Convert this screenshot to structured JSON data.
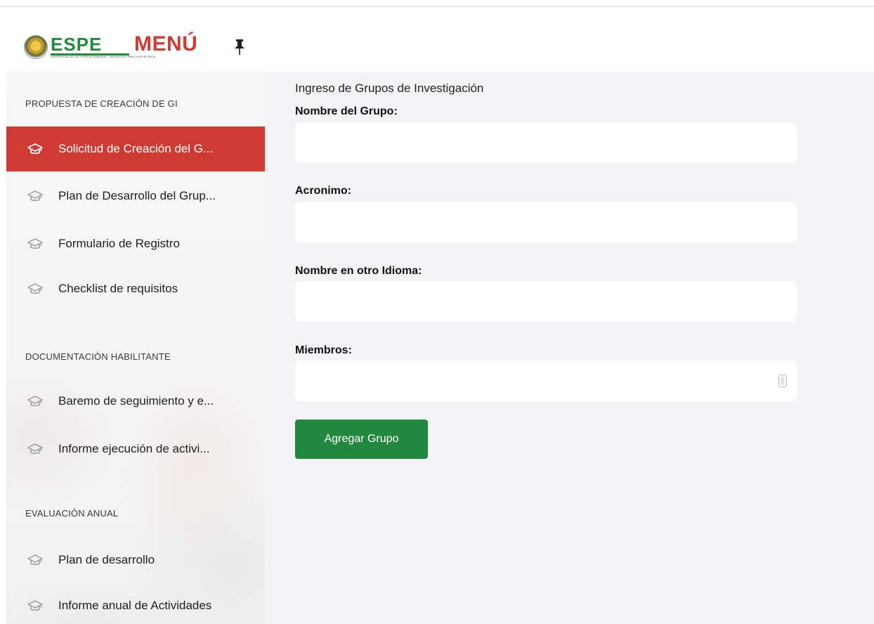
{
  "header": {
    "logo_word": "ESPE",
    "logo_tagline": "UNIVERSIDAD DE LAS FUERZAS ARMADAS · INNOVACIÓN PARA LA EXCELENCIA",
    "menu_title": "MENÚ",
    "pin_icon": "pin-icon"
  },
  "sidebar": {
    "sections": [
      {
        "title": "PROPUESTA DE CREACIÓN DE GI",
        "items": [
          {
            "label": "Solicitud de Creación del G...",
            "icon": "graduation-cap-icon",
            "active": true
          },
          {
            "label": "Plan de Desarrollo del Grup...",
            "icon": "graduation-cap-icon",
            "active": false
          },
          {
            "label": "Formulario de Registro",
            "icon": "graduation-cap-icon",
            "active": false
          },
          {
            "label": "Checklist de requisitos",
            "icon": "graduation-cap-icon",
            "active": false
          }
        ]
      },
      {
        "title": "DOCUMENTACIÓN HABILITANTE",
        "items": [
          {
            "label": "Baremo de seguimiento y e...",
            "icon": "graduation-cap-icon",
            "active": false
          },
          {
            "label": "Informe ejecución de activi...",
            "icon": "graduation-cap-icon",
            "active": false
          }
        ]
      },
      {
        "title": "EVALUACIÓN ANUAL",
        "items": [
          {
            "label": "Plan de desarrollo",
            "icon": "graduation-cap-icon",
            "active": false
          },
          {
            "label": "Informe anual de Actividades",
            "icon": "graduation-cap-icon",
            "active": false
          }
        ]
      }
    ]
  },
  "form": {
    "heading": "Ingreso de Grupos de Investigación",
    "fields": [
      {
        "label": "Nombre del Grupo:",
        "value": "",
        "placeholder": ""
      },
      {
        "label": "Acronimo:",
        "value": "",
        "placeholder": ""
      },
      {
        "label": "Nombre en otro Idioma:",
        "value": "",
        "placeholder": ""
      },
      {
        "label": "Miembros:",
        "value": "",
        "placeholder": ""
      }
    ],
    "submit_label": "Agregar Grupo"
  },
  "colors": {
    "accent_red": "#cf3b32",
    "menu_red": "#d13b33",
    "submit_green": "#22883f",
    "brand_green": "#1f8a3b"
  }
}
